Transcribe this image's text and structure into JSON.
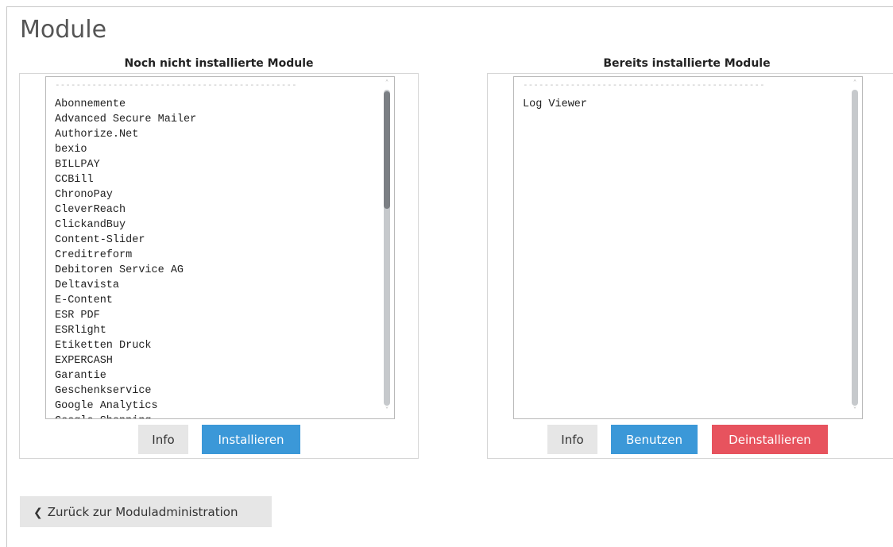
{
  "page": {
    "title": "Module"
  },
  "left_panel": {
    "heading": "Noch nicht installierte Module",
    "separator": "----------------------------------------------",
    "items": [
      "Abonnemente",
      "Advanced Secure Mailer",
      "Authorize.Net",
      "bexio",
      "BILLPAY",
      "CCBill",
      "ChronoPay",
      "CleverReach",
      "ClickandBuy",
      "Content-Slider",
      "Creditreform",
      "Debitoren Service AG",
      "Deltavista",
      "E-Content",
      "ESR PDF",
      "ESRlight",
      "Etiketten Druck",
      "EXPERCASH",
      "Garantie",
      "Geschenkservice",
      "Google Analytics",
      "Google Shopping"
    ],
    "buttons": {
      "info": "Info",
      "install": "Installieren"
    }
  },
  "right_panel": {
    "heading": "Bereits installierte Module",
    "separator": "----------------------------------------------",
    "items": [
      "Log Viewer"
    ],
    "buttons": {
      "info": "Info",
      "use": "Benutzen",
      "uninstall": "Deinstallieren"
    }
  },
  "footer": {
    "back_label": "Zurück zur Moduladministration"
  },
  "colors": {
    "primary": "#3b98d8",
    "danger": "#e7535e",
    "neutral": "#e6e6e6"
  },
  "icons": {
    "back": "chevron-left-icon",
    "scroll_up": "chevron-up-icon",
    "scroll_down": "chevron-down-icon"
  }
}
